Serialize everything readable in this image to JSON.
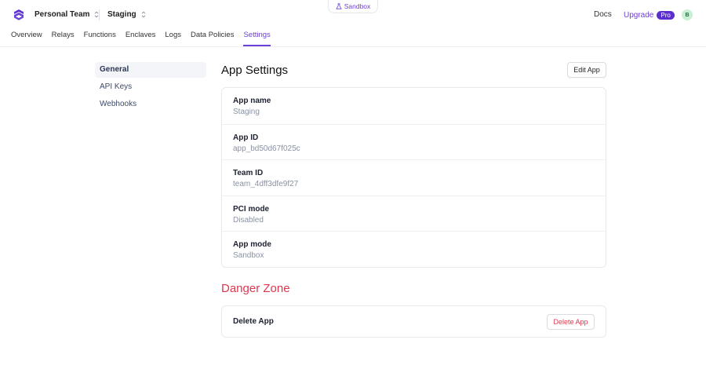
{
  "header": {
    "team_name": "Personal Team",
    "app_name": "Staging",
    "environment_badge": "Sandbox",
    "docs_link": "Docs",
    "upgrade_link": "Upgrade",
    "plan_badge": "Pro",
    "avatar_initial": "B",
    "brand_color": "#6d3fd6"
  },
  "nav": {
    "tabs": [
      {
        "label": "Overview"
      },
      {
        "label": "Relays"
      },
      {
        "label": "Functions"
      },
      {
        "label": "Enclaves"
      },
      {
        "label": "Logs"
      },
      {
        "label": "Data Policies"
      },
      {
        "label": "Settings"
      }
    ],
    "active": "Settings"
  },
  "sidebar": {
    "items": [
      {
        "label": "General"
      },
      {
        "label": "API Keys"
      },
      {
        "label": "Webhooks"
      }
    ],
    "active": "General"
  },
  "settings": {
    "title": "App Settings",
    "edit_button": "Edit App",
    "rows": [
      {
        "label": "App name",
        "value": "Staging"
      },
      {
        "label": "App ID",
        "value": "app_bd50d67f025c"
      },
      {
        "label": "Team ID",
        "value": "team_4dff3dfe9f27"
      },
      {
        "label": "PCI mode",
        "value": "Disabled"
      },
      {
        "label": "App mode",
        "value": "Sandbox"
      }
    ]
  },
  "danger": {
    "title": "Danger Zone",
    "label": "Delete App",
    "button": "Delete App",
    "color": "#e0364f"
  }
}
